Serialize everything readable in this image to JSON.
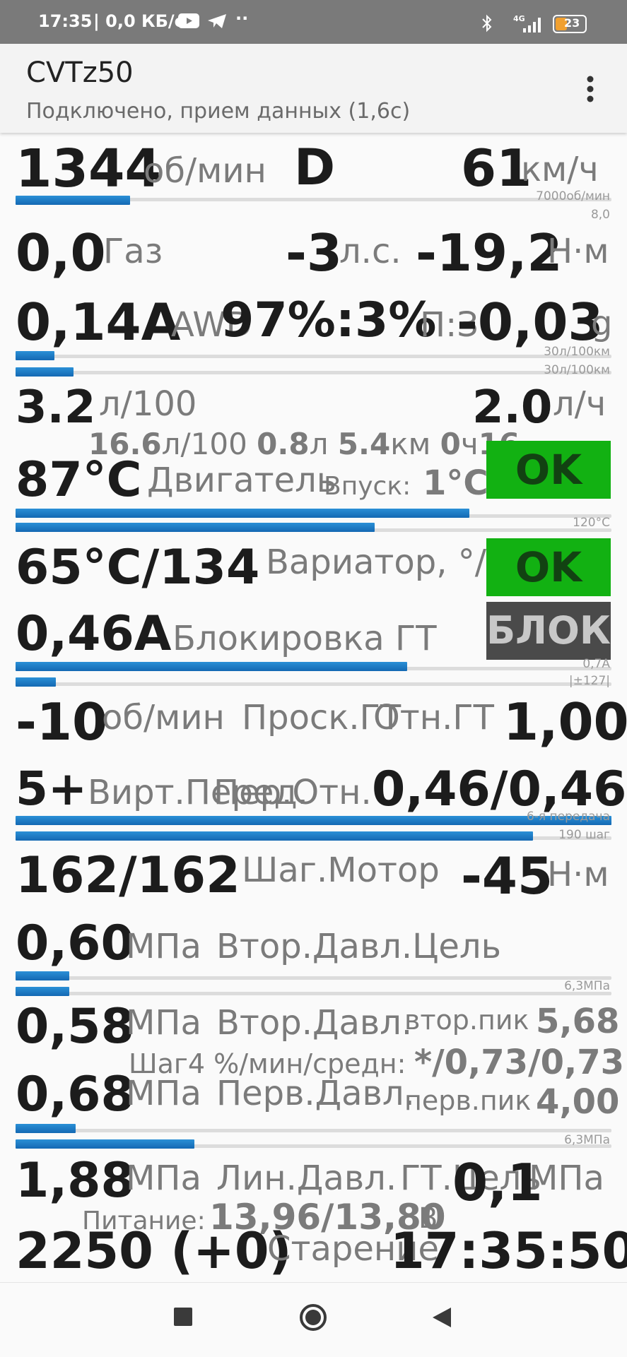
{
  "status_bar": {
    "time": "17:35",
    "net_speed": "| 0,0 КБ/с",
    "signal_label": "4G",
    "battery": "23",
    "icons": [
      "youtube-icon",
      "telegram-icon",
      "more-dots-icon",
      "bluetooth-icon",
      "signal-icon",
      "battery-icon"
    ]
  },
  "app_bar": {
    "title": "CVTz50",
    "subtitle": "Подключено, прием данных (1,6с)"
  },
  "rows": {
    "rpm": {
      "value": "1344",
      "unit": "об/мин",
      "gear": "D",
      "speed": "61",
      "speed_unit": "км/ч",
      "scale1": "7000об/мин",
      "scale2": "8,0"
    },
    "gas": {
      "value": "0,0",
      "label": "Газ",
      "hp": "-3",
      "hp_unit": "л.с.",
      "torque": "-19,2",
      "torque_unit": "Н·м"
    },
    "awd": {
      "value": "0,14A",
      "label": "AWD",
      "ratio": "97%:3%",
      "ratio_label": "П:З",
      "g": "-0,03",
      "g_unit": "g",
      "scale1": "30л/100км",
      "scale2": "30л/100км"
    },
    "fuel": {
      "value": "3.2",
      "unit": "л/100",
      "rate": "2.0",
      "rate_unit": "л/ч",
      "trip_avg": "16.6",
      "trip_avg_unit": "л/100",
      "trip_fuel": "0.8",
      "trip_fuel_unit": "л",
      "trip_dist": "5.4",
      "trip_dist_unit": "км",
      "trip_time": "0",
      "trip_time_unit": "ч",
      "trip_extra": "16"
    },
    "engine": {
      "value": "87°C",
      "label": "Двигатель",
      "intake_label": "Впуск:",
      "intake": "1°C",
      "status": "OK",
      "scale": "120°C"
    },
    "cvt": {
      "value": "65°C/134",
      "label": "Вариатор, °/у",
      "status": "OK"
    },
    "lockup": {
      "value": "0,46A",
      "label": "Блокировка ГТ",
      "status": "БЛОК",
      "scale1": "0,7A",
      "scale2": "|±127|"
    },
    "slip": {
      "value": "-10",
      "unit": "об/мин",
      "label": "Проск.ГТ",
      "label2": "Отн.ГТ",
      "ratio": "1,00"
    },
    "gear_virt": {
      "value": "5+",
      "label": "Вирт.Перед.",
      "label2": "Пер.Отн.",
      "ratio": "0,46/0,46",
      "scale1": "6-я передача",
      "scale2": "190 шаг"
    },
    "step": {
      "value": "162/162",
      "label": "Шаг.Мотор",
      "torque": "-45",
      "torque_unit": "Н·м"
    },
    "sec_target": {
      "value": "0,60",
      "unit": "МПа",
      "label": "Втор.Давл.Цель",
      "scale": "6,3МПа"
    },
    "sec": {
      "value": "0,58",
      "unit": "МПа",
      "label": "Втор.Давл.",
      "peak_label": "втор.пик",
      "peak": "5,68"
    },
    "step4": {
      "label": "Шаг4 %/мин/средн:",
      "value": "*/0,73/0,73"
    },
    "pri": {
      "value": "0,68",
      "unit": "МПа",
      "label": "Перв.Давл.",
      "peak_label": "перв.пик",
      "peak": "4,00",
      "scale": "6,3МПа"
    },
    "line": {
      "value": "1,88",
      "unit": "МПа",
      "label": "Лин.Давл.",
      "label2": "ГТ.Цель",
      "target": "0,1",
      "target_unit": "МПа"
    },
    "power": {
      "label": "Питание:",
      "value": "13,96/13,80",
      "unit": "В"
    },
    "aging": {
      "value": "2250 (+0)",
      "label": "Старение",
      "clock": "17:35:50"
    }
  },
  "bars": {
    "rpm": 0.192,
    "awd_1": 0.065,
    "awd_2": 0.097,
    "engine_1": 0.762,
    "engine_2": 0.603,
    "lockup_1": 0.657,
    "lockup_2": 0.068,
    "gear_1": 1.0,
    "gear_2": 0.868,
    "sec_target_1": 0.09,
    "sec_target_2": 0.09,
    "pri_1": 0.101,
    "pri_2": 0.3
  },
  "colors": {
    "bar": "#1a7cc6",
    "ok": "#12b112",
    "block": "#4a4a4a",
    "status_bar": "#7a7a7a"
  }
}
